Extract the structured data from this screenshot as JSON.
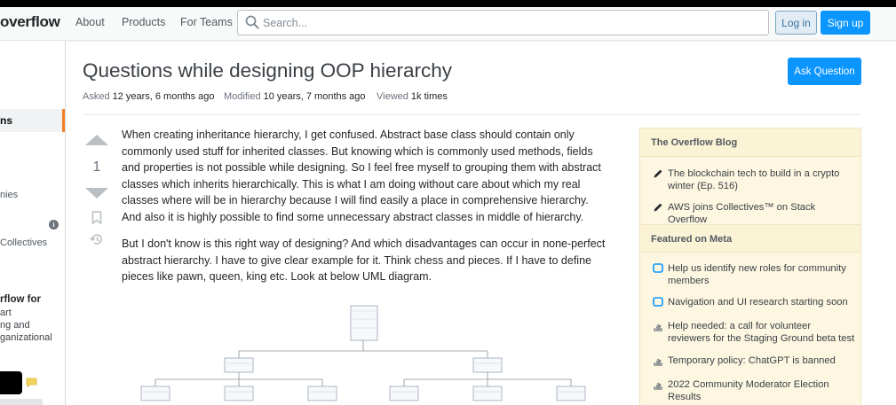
{
  "topbar": {
    "logo_text": "overflow",
    "nav": [
      "About",
      "Products",
      "For Teams"
    ],
    "search_placeholder": "Search...",
    "login_label": "Log in",
    "signup_label": "Sign up"
  },
  "leftnav": {
    "active_label": "ns",
    "item_companies": "nies",
    "item_collectives": "Collectives",
    "info_glyph": "i",
    "teams_title": "rflow for",
    "teams_lines": [
      "art",
      "ng and",
      "ganizational"
    ]
  },
  "question": {
    "title": "Questions while designing OOP hierarchy",
    "ask_button": "Ask Question",
    "asked_label": "Asked",
    "asked_value": "12 years, 6 months ago",
    "modified_label": "Modified",
    "modified_value": "10 years, 7 months ago",
    "viewed_label": "Viewed",
    "viewed_value": "1k times",
    "votes": "1",
    "body": [
      "When creating inheritance hierarchy, I get confused. Abstract base class should contain only commonly used stuff for inherited classes. But knowing which is commonly used methods, fields and properties is not possible while designing. So I feel free myself to grouping them with abstract classes which inherits hierarchically. This is what I am doing without care about which my real classes where will be in hierarchy because I will find easily a place in comprehensive hierarchy. And also it is highly possible to find some unnecessary abstract classes in middle of hierarchy.",
      "But I don't know is this right way of designing? And which disadvantages can occur in none-perfect abstract hierarchy. I have to give clear example for it. Think chess and pieces. If I have to define pieces like pawn, queen, king etc. Look at below UML diagram."
    ]
  },
  "sidebar": {
    "blog_heading": "The Overflow Blog",
    "blog_items": [
      "The blockchain tech to build in a crypto winter (Ep. 516)",
      "AWS joins Collectives™ on Stack Overflow"
    ],
    "meta_heading": "Featured on Meta",
    "meta_items": [
      "Help us identify new roles for community members",
      "Navigation and UI research starting soon",
      "Help needed: a call for volunteer reviewers for the Staging Ground beta test",
      "Temporary policy: ChatGPT is banned",
      "2022 Community Moderator Election Results"
    ]
  },
  "colors": {
    "accent_orange": "#f48225",
    "primary_blue": "#0a95ff",
    "sidebar_bg": "#fdf7e2"
  }
}
